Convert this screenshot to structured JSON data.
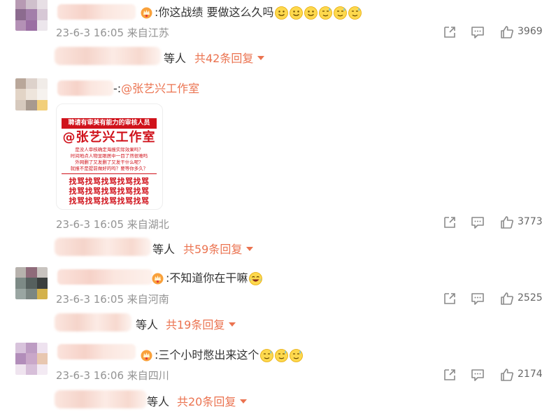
{
  "comments": [
    {
      "text": ":你这战绩 要做这么久吗",
      "emojis": [
        "smile",
        "smile",
        "smile",
        "sweat",
        "sweat",
        "sweat"
      ],
      "meta": "23-6-3 16:05 来自江苏",
      "likes": "3969",
      "reply_suffix": "等人",
      "reply_link": "共42条回复"
    },
    {
      "text_prefix": "-:",
      "mention": "@张艺兴工作室",
      "meta": "23-6-3 16:05 来自湖北",
      "likes": "3773",
      "reply_suffix": "等人",
      "reply_link": "共59条回复",
      "poster": {
        "bar": "聘请有审美有能力的审核人员",
        "big": "@张艺兴工作室",
        "lines": [
          "是没人审核确定海报实际效果吗？",
          "时间地点人物显眼居中一目了然很难吗",
          "外网删了又发删了又发干什么呢？",
          "就报不是提前做好的吗？要等你多久？"
        ],
        "grid": [
          "找骂找骂找骂找骂找骂",
          "找骂找骂找骂找骂找骂",
          "找骂找骂找骂找骂找骂"
        ]
      }
    },
    {
      "text": ":不知道你在干嘛",
      "emojis": [
        "laugh"
      ],
      "meta": "23-6-3 16:05 来自河南",
      "likes": "2525",
      "reply_suffix": "等人",
      "reply_link": "共19条回复"
    },
    {
      "text": ":三个小时憋出来这个",
      "emojis": [
        "sweat",
        "sweat",
        "sweat"
      ],
      "meta": "23-6-3 16:06 来自四川",
      "likes": "2174",
      "reply_suffix": "等人",
      "reply_link": "共20条回复"
    }
  ],
  "colors": {
    "accent": "#eb7350",
    "meta": "#939393",
    "poster_red": "#d0121b"
  },
  "icons": [
    "share-icon",
    "comment-icon",
    "like-icon",
    "vip-crown-icon",
    "chevron-down-icon"
  ]
}
